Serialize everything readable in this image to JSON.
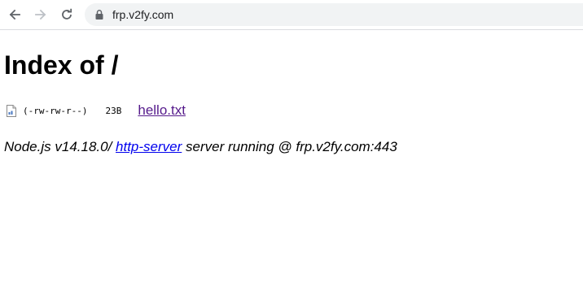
{
  "browser": {
    "url": "frp.v2fy.com",
    "icons": {
      "back": "arrow-left-icon",
      "forward": "arrow-right-icon",
      "reload": "reload-icon",
      "lock": "lock-icon"
    },
    "colors": {
      "omnibox_bg": "#f1f3f4",
      "icon_active": "#5f6368",
      "icon_disabled": "#bdc1c6"
    }
  },
  "page": {
    "title": "Index of /",
    "files": [
      {
        "icon": "file-icon",
        "permissions": "(-rw-rw-r--)",
        "size": "23B",
        "name": "hello.txt"
      }
    ],
    "footer": {
      "prefix": "Node.js v14.18.0/ ",
      "link_text": "http-server",
      "suffix": " server running @ frp.v2fy.com:443"
    },
    "colors": {
      "visited_link": "#551a8b",
      "link": "#0000ee"
    }
  }
}
